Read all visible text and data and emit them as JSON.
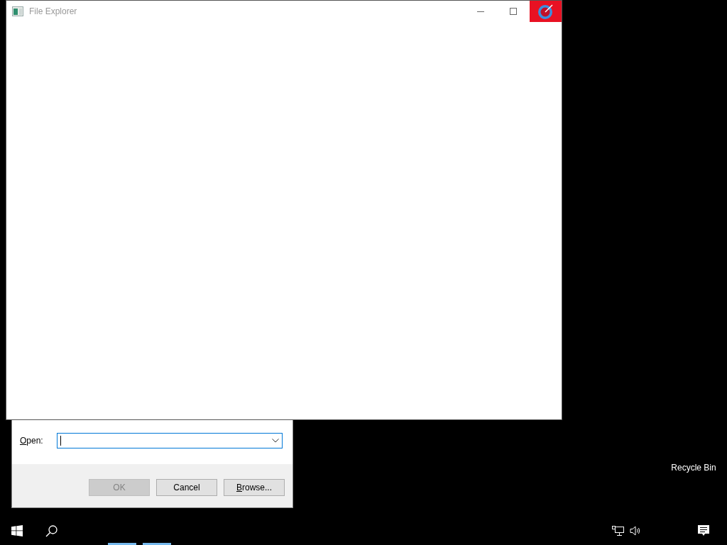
{
  "desktop": {
    "icons": [
      {
        "label": "Recycle Bin"
      }
    ]
  },
  "explorer_window": {
    "title": "File Explorer"
  },
  "run_dialog": {
    "open_label": "Open:",
    "buttons": [
      {
        "label": "OK",
        "disabled": true
      },
      {
        "label": "Cancel",
        "disabled": false
      },
      {
        "label": "Browse...",
        "disabled": false
      }
    ]
  }
}
